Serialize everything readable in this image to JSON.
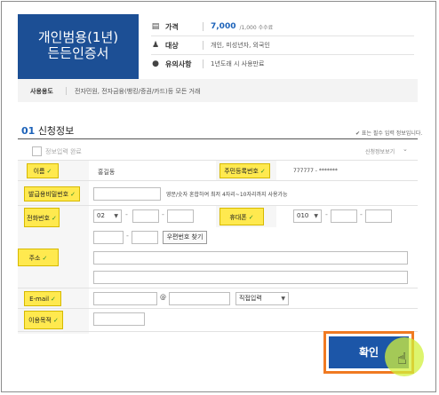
{
  "header": {
    "cert_line1": "개인범용(1년)",
    "cert_line2": "든든인증서",
    "price_label": "가격",
    "price_value": "7,000",
    "price_note": "/1,000 수수료",
    "target_label": "대상",
    "target_value": "개인, 미성년자, 외국인",
    "validity_label": "유의사항",
    "validity_value": "1년도래 시 사용만료"
  },
  "usage": {
    "label": "사용용도",
    "value": "전자민원, 전자금융(뱅킹/증권/카드)등 모든 거래"
  },
  "section": {
    "number": "01",
    "title": "신청정보",
    "required_note": "✔ 표는 필수 입력 정보입니다.",
    "saved_checkbox_label": "정보입력 완료",
    "toggle_label": "신청정보보기"
  },
  "form": {
    "name_label": "이름",
    "name_value": "홍길동",
    "rrn_label": "주민등록번호",
    "rrn_value": "777777 - *******",
    "password_label": "발급용비밀번호",
    "password_hint": "영문/숫자 혼합하여 최저 4자리~10자리까지 사용가능",
    "phone_label": "전화번호",
    "phone_prefix": "02",
    "mobile_label": "휴대폰",
    "mobile_prefix": "010",
    "zip_button": "우편번호 찾기",
    "address_label": "주소",
    "email_label": "E-mail",
    "email_at": "@",
    "email_domain_select": "직접입력",
    "purpose_label": "이용목적"
  },
  "actions": {
    "confirm_label": "확인"
  },
  "colors": {
    "brand_blue": "#1c4f95",
    "highlight_yellow": "#ffe94f",
    "confirm_outline": "#f07a22"
  }
}
